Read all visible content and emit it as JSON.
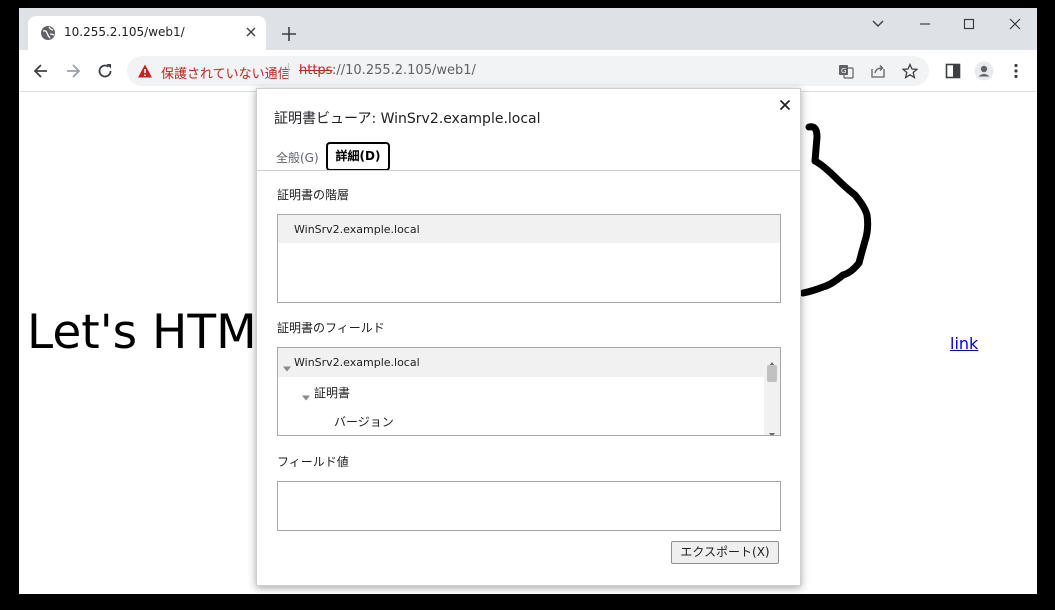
{
  "browser": {
    "tab": {
      "title": "10.255.2.105/web1/"
    },
    "address": {
      "security_text": "保護されていない通信",
      "scheme": "https",
      "rest": "://10.255.2.105/web1/"
    }
  },
  "page": {
    "heading": "Let's HTM",
    "link": "link"
  },
  "dialog": {
    "title": "証明書ビューア: WinSrv2.example.local",
    "tabs": {
      "general": "全般(G)",
      "details": "詳細(D)"
    },
    "hierarchy": {
      "label": "証明書の階層",
      "item": "WinSrv2.example.local"
    },
    "fields": {
      "label": "証明書のフィールド",
      "items": [
        "WinSrv2.example.local",
        "証明書",
        "バージョン"
      ]
    },
    "field_value": {
      "label": "フィールド値",
      "value": ""
    },
    "export_button": "エクスポート(X)"
  },
  "colors": {
    "tabstrip": "#dee1e6",
    "insecure_red": "#c5221f",
    "link_blue": "#0000ee"
  },
  "icons": {
    "tab_favicon": "globe-icon",
    "back": "arrow-left-icon",
    "forward": "arrow-right-icon",
    "reload": "reload-icon",
    "warning": "warning-triangle-icon",
    "translate": "translate-icon",
    "share": "share-icon",
    "bookmark": "star-icon",
    "sidepanel": "side-panel-icon",
    "profile": "profile-icon",
    "menu": "kebab-menu-icon"
  }
}
